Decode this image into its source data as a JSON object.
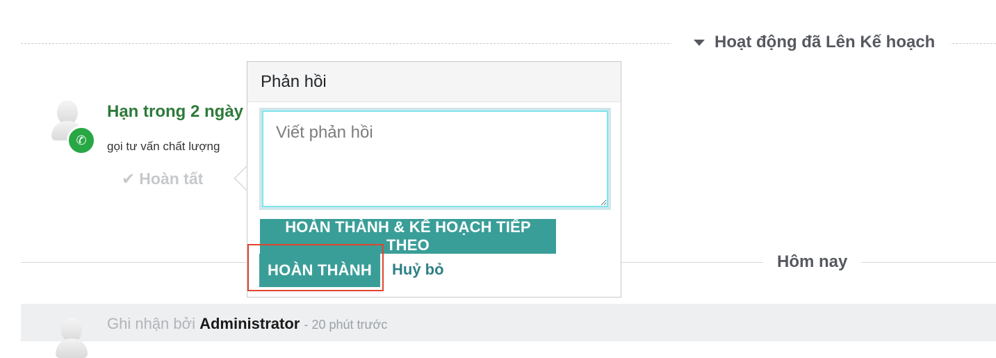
{
  "planned_section": {
    "label": "Hoạt động đã Lên Kế hoạch",
    "caret_icon": "caret-down-icon"
  },
  "activity": {
    "title": "Hạn trong 2 ngày",
    "note": "gọi tư vấn chất lượng",
    "done_label": "Hoàn tất",
    "type_icon": "phone-icon",
    "badge_color": "#28a745"
  },
  "popover": {
    "title": "Phản hồi",
    "feedback_placeholder": "Viết phản hồi",
    "done_schedule_next_label": "HOÀN THÀNH & KẾ HOẠCH TIẾP THEO",
    "done_label": "HOÀN THÀNH",
    "cancel_label": "Huỷ bỏ",
    "button_color": "#3a9e98"
  },
  "today_section": {
    "label": "Hôm nay"
  },
  "message": {
    "prefix": "Ghi nhận bởi",
    "author": "Administrator",
    "time": "- 20 phút trước"
  },
  "highlight_color": "#e0452f"
}
